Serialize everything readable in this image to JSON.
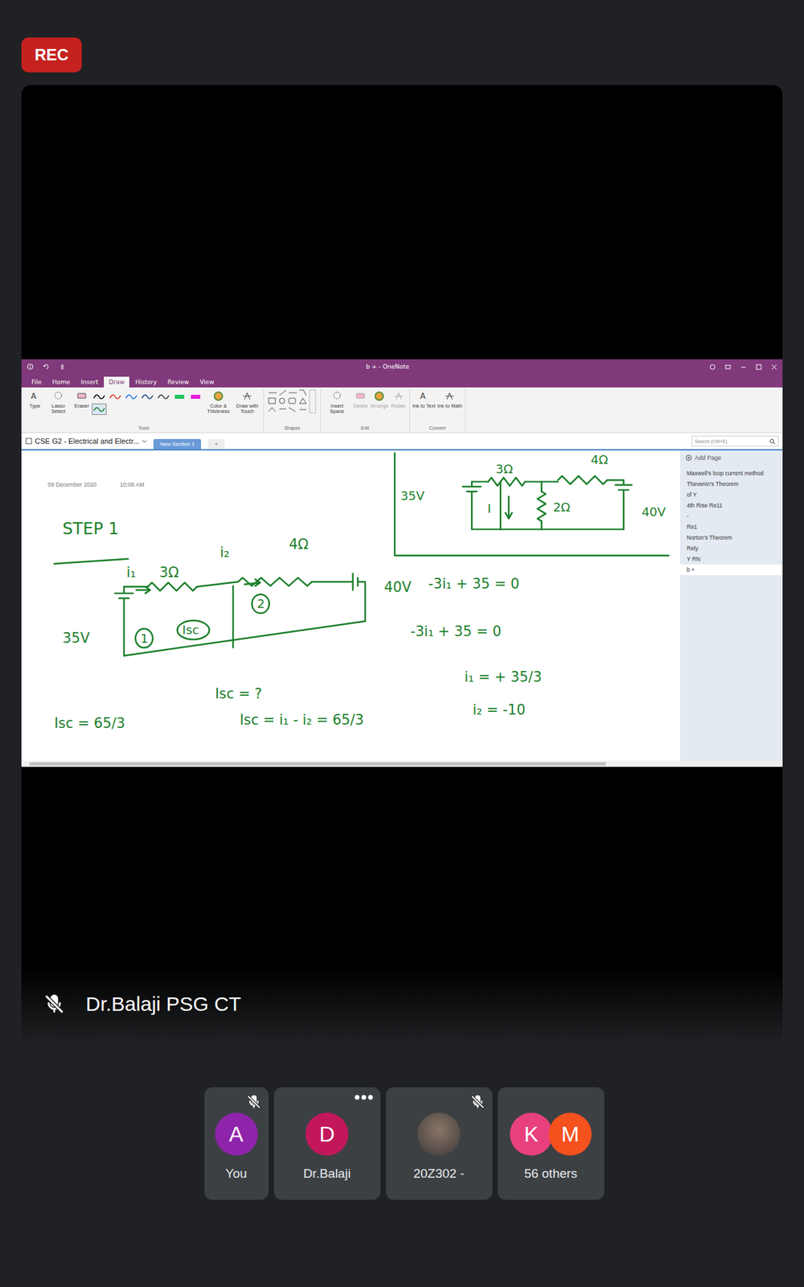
{
  "recording": {
    "label": "REC"
  },
  "presenter": {
    "name": "Dr.Balaji PSG CT",
    "muted": true
  },
  "share": {
    "title": "b + - OneNote",
    "menu_tabs": [
      {
        "label": "File",
        "selected": false
      },
      {
        "label": "Home",
        "selected": false
      },
      {
        "label": "Insert",
        "selected": false
      },
      {
        "label": "Draw",
        "selected": true
      },
      {
        "label": "History",
        "selected": false
      },
      {
        "label": "Review",
        "selected": false
      },
      {
        "label": "View",
        "selected": false
      }
    ],
    "ribbon": {
      "tools": {
        "label": "Tools",
        "buttons": [
          {
            "label": "Type",
            "disabled": false
          },
          {
            "label": "Lasso Select",
            "disabled": false
          },
          {
            "label": "Eraser",
            "disabled": false
          }
        ],
        "pens": [
          {
            "color": "#000000",
            "kind": "pen",
            "selected": false
          },
          {
            "color": "#d93025",
            "kind": "pen",
            "selected": false
          },
          {
            "color": "#1a73e8",
            "kind": "pen",
            "selected": false
          },
          {
            "color": "#1a3d7a",
            "kind": "pen",
            "selected": false
          },
          {
            "color": "#333333",
            "kind": "pen",
            "selected": false
          },
          {
            "color": "#22c55e",
            "kind": "highlighter",
            "selected": false
          },
          {
            "color": "#e91ee0",
            "kind": "highlighter",
            "selected": false
          },
          {
            "color": "#1b7f2a",
            "kind": "pen",
            "selected": true
          }
        ],
        "more": [
          {
            "label": "Color & Thickness",
            "disabled": false
          },
          {
            "label": "Draw with Touch",
            "disabled": false
          }
        ]
      },
      "shapes": {
        "label": "Shapes"
      },
      "edit": {
        "label": "Edit",
        "buttons": [
          {
            "label": "Insert Space",
            "disabled": false
          },
          {
            "label": "Delete",
            "disabled": true
          },
          {
            "label": "Arrange",
            "disabled": true
          },
          {
            "label": "Rotate",
            "disabled": true
          }
        ]
      },
      "convert": {
        "label": "Convert",
        "buttons": [
          {
            "label": "Ink to Text",
            "disabled": false
          },
          {
            "label": "Ink to Math",
            "disabled": false
          }
        ]
      }
    },
    "notebook": "CSE G2 - Electrical and Electr...",
    "sections": [
      {
        "label": "New Section 1",
        "selected": true
      },
      {
        "label": "+",
        "selected": false
      }
    ],
    "search": {
      "placeholder": "Search (Ctrl+E)"
    },
    "page_date": "09 December 2020",
    "page_time": "10:08 AM",
    "notes": [
      {
        "text": "STEP 1",
        "circled": false
      },
      {
        "text": "i₁",
        "circled": false
      },
      {
        "text": "3Ω",
        "circled": false
      },
      {
        "text": "i₂",
        "circled": false
      },
      {
        "text": "4Ω",
        "circled": false
      },
      {
        "text": "35V",
        "circled": false
      },
      {
        "text": "1",
        "circled": true
      },
      {
        "text": "Isc",
        "circled": true
      },
      {
        "text": "2",
        "circled": true
      },
      {
        "text": "40V",
        "circled": false
      },
      {
        "text": "-3i₁ + 35 = 0",
        "circled": false
      },
      {
        "text": "-3i₁ + 35 = 0",
        "circled": false
      },
      {
        "text": "i₁ = + 35/3",
        "circled": false
      },
      {
        "text": "i₂ = -10",
        "circled": false
      },
      {
        "text": "Isc = ?",
        "circled": false
      },
      {
        "text": "Isc = i₁ - i₂ = 65/3",
        "circled": false
      },
      {
        "text": "Isc = 65/3",
        "circled": false
      },
      {
        "text": "35V",
        "circled": false
      },
      {
        "text": "3Ω",
        "circled": false
      },
      {
        "text": "4Ω",
        "circled": false
      },
      {
        "text": "I",
        "circled": false
      },
      {
        "text": "2Ω",
        "circled": false
      },
      {
        "text": "40V",
        "circled": false
      }
    ],
    "pages": {
      "add_label": "Add Page",
      "items": [
        {
          "label": "Maxwell's loop current method",
          "selected": false
        },
        {
          "label": "Thevenin's Theorem",
          "selected": false
        },
        {
          "label": "of Y",
          "selected": false
        },
        {
          "label": "4th Rise Re11",
          "selected": false
        },
        {
          "label": "-",
          "selected": false
        },
        {
          "label": "Re1",
          "selected": false
        },
        {
          "label": "Norton's Theorem",
          "selected": false
        },
        {
          "label": "Rely",
          "selected": false
        },
        {
          "label": "Y RN",
          "selected": false
        },
        {
          "label": "b +",
          "selected": true
        }
      ]
    }
  },
  "participants": [
    {
      "name": "You",
      "kind": "initial",
      "initial": "A",
      "color": "#8e24aa",
      "muted": true,
      "menu": false
    },
    {
      "name": "Dr.Balaji",
      "kind": "initial",
      "initial": "D",
      "color": "#c2185b",
      "muted": false,
      "menu": true
    },
    {
      "name": "20Z302 -",
      "kind": "photo",
      "muted": true,
      "menu": false
    },
    {
      "name": "56 others",
      "kind": "group",
      "muted": false,
      "menu": false,
      "initials": [
        {
          "letter": "K",
          "color": "#e8407c"
        },
        {
          "letter": "M",
          "color": "#f4511e"
        }
      ]
    }
  ]
}
